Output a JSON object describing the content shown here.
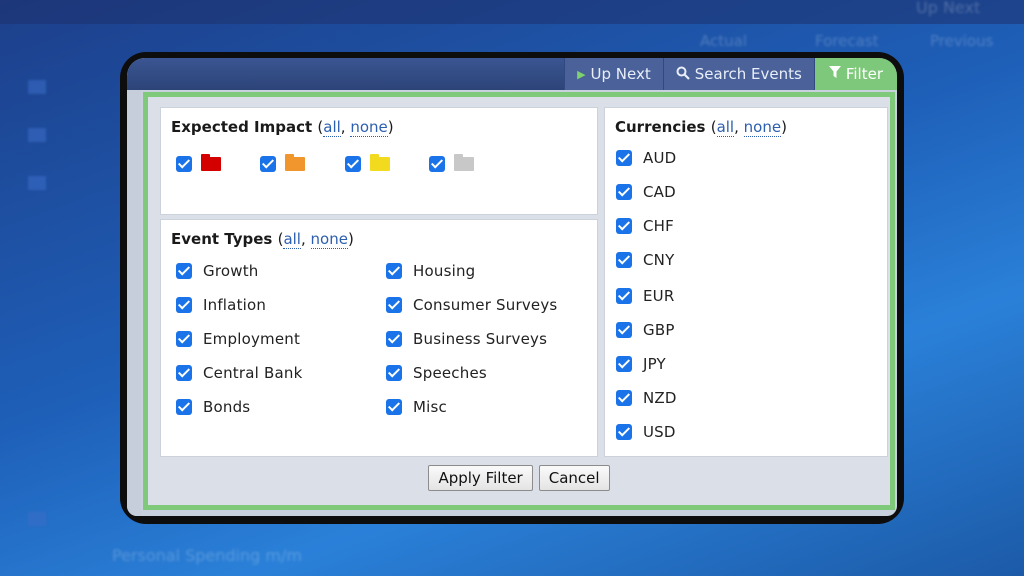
{
  "background": {
    "up_next": "Up Next",
    "headers": [
      "Actual",
      "Forecast",
      "Previous"
    ],
    "row_text": "Personal Spending m/m"
  },
  "tabs": [
    {
      "label": "Up Next",
      "icon": "play-icon"
    },
    {
      "label": "Search Events",
      "icon": "search-icon"
    },
    {
      "label": "Filter",
      "icon": "filter-icon",
      "active": true
    }
  ],
  "impact": {
    "title": "Expected Impact",
    "all": "all",
    "none": "none",
    "items": [
      {
        "icon": "impact-high-folder-icon",
        "color": "#d40000",
        "checked": true
      },
      {
        "icon": "impact-medium-folder-icon",
        "color": "#f0962c",
        "checked": true
      },
      {
        "icon": "impact-low-folder-icon",
        "color": "#f2db1f",
        "checked": true
      },
      {
        "icon": "impact-none-folder-icon",
        "color": "#c8c8c8",
        "checked": true
      }
    ]
  },
  "event_types": {
    "title": "Event Types",
    "all": "all",
    "none": "none",
    "left": [
      "Growth",
      "Inflation",
      "Employment",
      "Central Bank",
      "Bonds"
    ],
    "right": [
      "Housing",
      "Consumer Surveys",
      "Business Surveys",
      "Speeches",
      "Misc"
    ]
  },
  "currencies": {
    "title": "Currencies",
    "all": "all",
    "none": "none",
    "items": [
      "AUD",
      "CAD",
      "CHF",
      "CNY",
      "EUR",
      "GBP",
      "JPY",
      "NZD",
      "USD"
    ]
  },
  "buttons": {
    "apply": "Apply Filter",
    "cancel": "Cancel"
  },
  "colors": {
    "accent_green": "#7fc97a",
    "checkbox_blue": "#1a73e8",
    "link_blue": "#2c5fb0"
  }
}
